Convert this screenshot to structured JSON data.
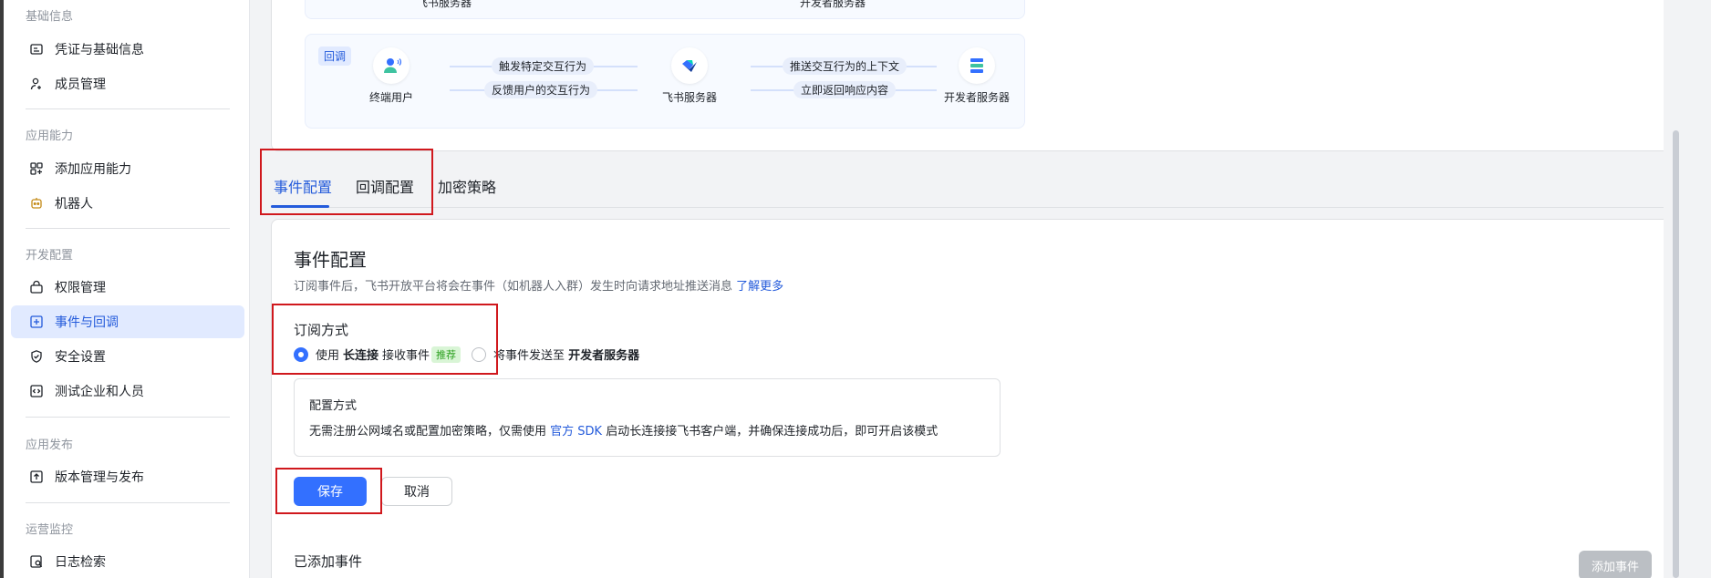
{
  "sidebar": {
    "groups": [
      {
        "label": "基础信息",
        "items": [
          "凭证与基础信息",
          "成员管理"
        ]
      },
      {
        "label": "应用能力",
        "items": [
          "添加应用能力",
          "机器人"
        ]
      },
      {
        "label": "开发配置",
        "items": [
          "权限管理",
          "事件与回调",
          "安全设置",
          "测试企业和人员"
        ]
      },
      {
        "label": "应用发布",
        "items": [
          "版本管理与发布"
        ]
      },
      {
        "label": "运营监控",
        "items": [
          "日志检索"
        ]
      }
    ],
    "active": "事件与回调"
  },
  "flow": {
    "top_cut": [
      "飞书服务器",
      "开发者服务器"
    ],
    "tag": "回调",
    "nodes": [
      "终端用户",
      "飞书服务器",
      "开发者服务器"
    ],
    "arrows": {
      "a1": "触发特定交互行为",
      "a2": "反馈用户的交互行为",
      "a3": "推送交互行为的上下文",
      "a4": "立即返回响应内容"
    }
  },
  "tabs": [
    "事件配置",
    "回调配置",
    "加密策略"
  ],
  "event_config": {
    "title": "事件配置",
    "desc": "订阅事件后，飞书开放平台将会在事件（如机器人入群）发生时向请求地址推送消息",
    "learn_more": "了解更多",
    "subscribe_title": "订阅方式",
    "opt1": {
      "pre": "使用",
      "bold": "长连接",
      "post": "接收事件",
      "badge": "推荐"
    },
    "opt2": {
      "pre": "将事件发送至",
      "bold": "开发者服务器"
    },
    "cfg_title": "配置方式",
    "cfg_desc_pre": "无需注册公网域名或配置加密策略，仅需使用",
    "cfg_link": "官方 SDK",
    "cfg_desc_post": "启动长连接接飞书客户端，并确保连接成功后，即可开启该模式",
    "save": "保存",
    "cancel": "取消",
    "added_title": "已添加事件",
    "add_event": "添加事件"
  },
  "colors": {
    "accent": "#3370ff",
    "highlight": "#d0181d"
  }
}
